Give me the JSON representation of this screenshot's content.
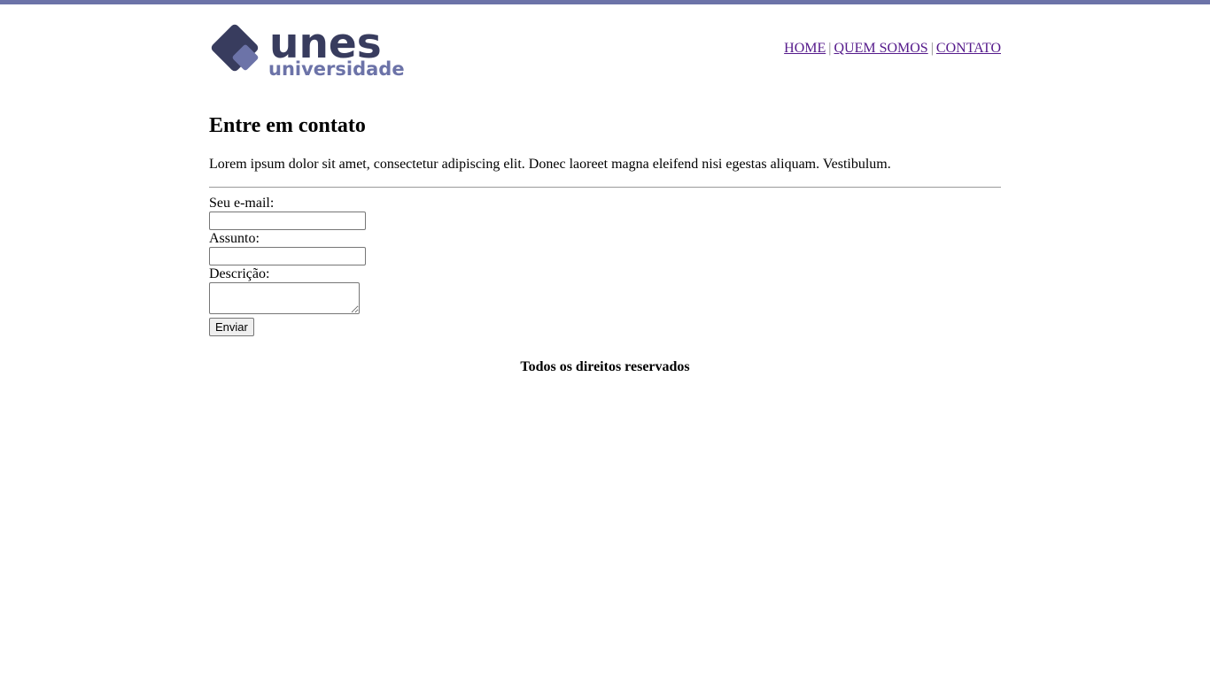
{
  "brand": {
    "logo_main": "unes",
    "logo_sub": "universidade",
    "color_dark": "#383c5e",
    "color_light": "#6c73a8"
  },
  "nav": {
    "items": [
      "HOME",
      "QUEM SOMOS",
      "CONTATO"
    ],
    "separator": "|"
  },
  "main": {
    "title": "Entre em contato",
    "intro": "Lorem ipsum dolor sit amet, consectetur adipiscing elit. Donec laoreet magna eleifend nisi egestas aliquam. Vestibulum."
  },
  "form": {
    "email_label": "Seu e-mail:",
    "email_value": "",
    "subject_label": "Assunto:",
    "subject_value": "",
    "description_label": "Descrição:",
    "description_value": "",
    "submit_label": "Enviar"
  },
  "footer": {
    "text": "Todos os direitos reservados"
  }
}
